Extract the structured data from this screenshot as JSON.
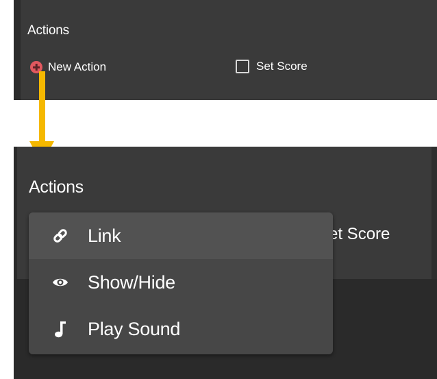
{
  "before": {
    "title": "Actions",
    "new_action_label": "New Action",
    "set_score_label": "Set Score",
    "set_score_checked": false
  },
  "after": {
    "title": "Actions",
    "set_score_partial_label": "et Score"
  },
  "menu": {
    "items": [
      {
        "label": "Link",
        "icon": "link-icon"
      },
      {
        "label": "Show/Hide",
        "icon": "eye-icon"
      },
      {
        "label": "Play Sound",
        "icon": "music-note-icon"
      }
    ],
    "highlighted_index": 0
  },
  "colors": {
    "panel_background": "#3a3a3a",
    "add_button_accent": "#e2585f",
    "arrow": "#f5b800",
    "menu_background": "#474747",
    "menu_highlight": "#525252"
  }
}
